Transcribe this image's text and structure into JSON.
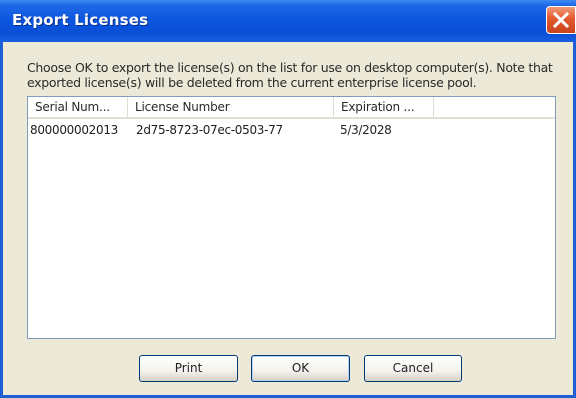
{
  "window": {
    "title": "Export Licenses"
  },
  "message": {
    "line1": "Choose OK to export the license(s) on the list for use on desktop computer(s).  Note that",
    "line2": "exported license(s) will be deleted from the current enterprise license pool."
  },
  "list": {
    "columns": [
      "Serial Num...",
      "License Number",
      "Expiration ...",
      ""
    ],
    "rows": [
      {
        "serial": "800000002013",
        "license": "2d75-8723-07ec-0503-77",
        "expiration": "5/3/2028"
      }
    ]
  },
  "buttons": {
    "print": "Print",
    "ok": "OK",
    "cancel": "Cancel"
  },
  "icons": {
    "close": "close-icon"
  },
  "colors": {
    "titlebar": "#0b55df",
    "close": "#e55a2e",
    "dialog_bg": "#ece9d8"
  }
}
